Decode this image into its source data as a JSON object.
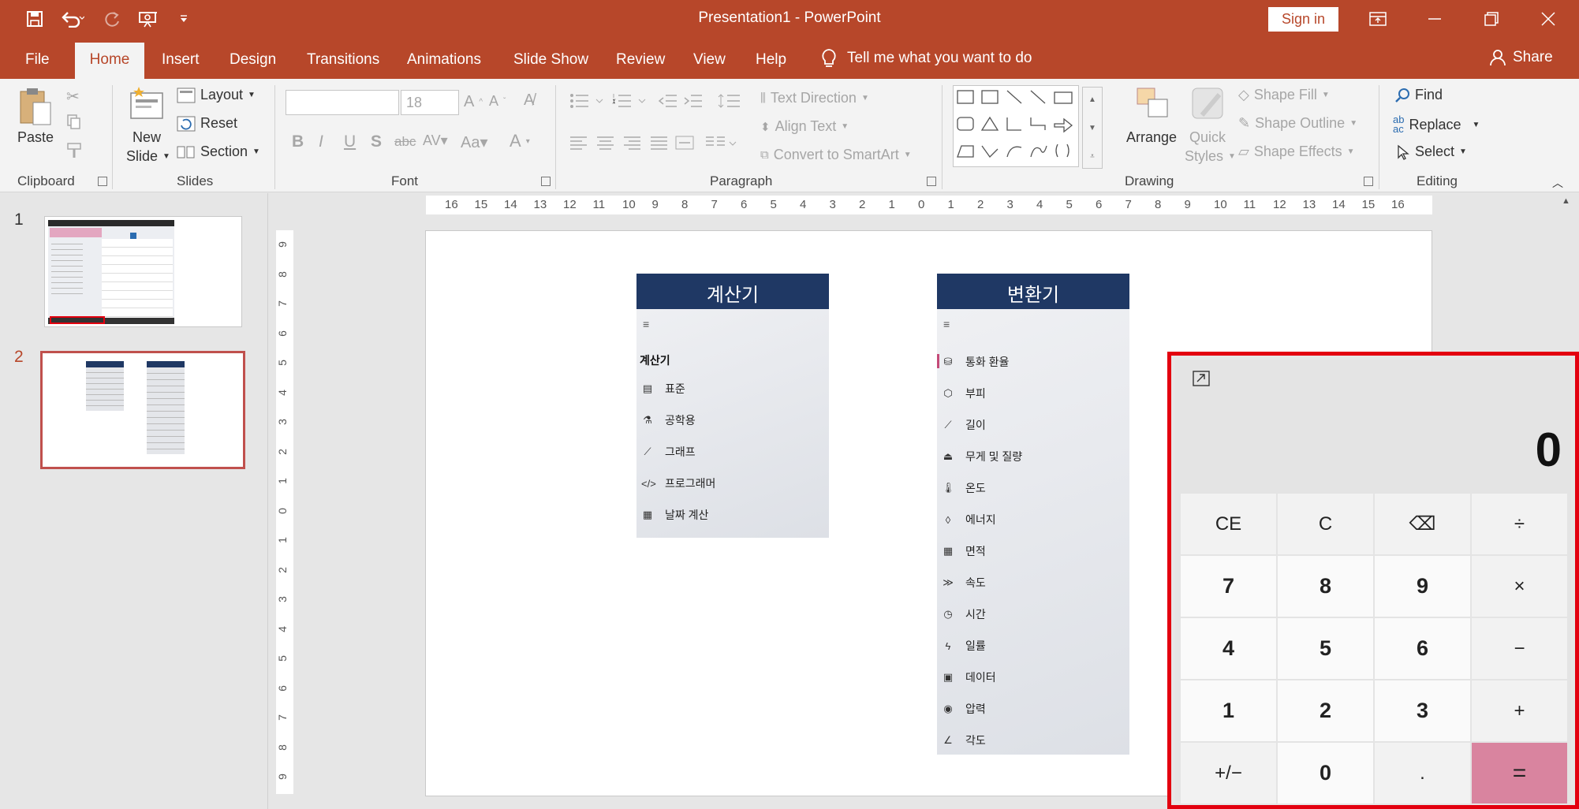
{
  "window": {
    "title": "Presentation1  -  PowerPoint",
    "sign_in": "Sign in"
  },
  "tabs": [
    "File",
    "Home",
    "Insert",
    "Design",
    "Transitions",
    "Animations",
    "Slide Show",
    "Review",
    "View",
    "Help"
  ],
  "tell_me": "Tell me what you want to do",
  "share": "Share",
  "ribbon": {
    "clipboard": {
      "label": "Clipboard",
      "paste": "Paste"
    },
    "slides": {
      "label": "Slides",
      "new_slide_1": "New",
      "new_slide_2": "Slide",
      "layout": "Layout",
      "reset": "Reset",
      "section": "Section"
    },
    "font": {
      "label": "Font",
      "size": "18"
    },
    "paragraph": {
      "label": "Paragraph",
      "text_direction": "Text Direction",
      "align_text": "Align Text",
      "convert_smartart": "Convert to SmartArt"
    },
    "drawing": {
      "label": "Drawing",
      "arrange": "Arrange",
      "quick_1": "Quick",
      "quick_2": "Styles",
      "shape_fill": "Shape Fill",
      "shape_outline": "Shape Outline",
      "shape_effects": "Shape Effects"
    },
    "editing": {
      "label": "Editing",
      "find": "Find",
      "replace": "Replace",
      "select": "Select"
    }
  },
  "slides_pane": [
    "1",
    "2"
  ],
  "ruler": {
    "h": [
      "16",
      "15",
      "14",
      "13",
      "12",
      "11",
      "10",
      "9",
      "8",
      "7",
      "6",
      "5",
      "4",
      "3",
      "2",
      "1",
      "0",
      "1",
      "2",
      "3",
      "4",
      "5",
      "6",
      "7",
      "8",
      "9",
      "10",
      "11",
      "12",
      "13",
      "14",
      "15",
      "16"
    ],
    "v": [
      "9",
      "8",
      "7",
      "6",
      "5",
      "4",
      "3",
      "2",
      "1",
      "0",
      "1",
      "2",
      "3",
      "4",
      "5",
      "6",
      "7",
      "8",
      "9"
    ]
  },
  "calc_panel": {
    "title": "계산기",
    "menu": "≡",
    "header": "계산기",
    "items": [
      "표준",
      "공학용",
      "그래프",
      "프로그래머",
      "날짜 계산"
    ]
  },
  "conv_panel": {
    "title": "변환기",
    "menu": "≡",
    "items": [
      "통화 환율",
      "부피",
      "길이",
      "무게 및 질량",
      "온도",
      "에너지",
      "면적",
      "속도",
      "시간",
      "일률",
      "데이터",
      "압력",
      "각도"
    ]
  },
  "calculator": {
    "display": "0",
    "keys": [
      [
        "CE",
        "C",
        "⌫",
        "÷"
      ],
      [
        "7",
        "8",
        "9",
        "×"
      ],
      [
        "4",
        "5",
        "6",
        "−"
      ],
      [
        "1",
        "2",
        "3",
        "+"
      ],
      [
        "+/−",
        "0",
        ".",
        "="
      ]
    ]
  },
  "colors": {
    "accent": "#b7472a",
    "panel_header": "#1f3864",
    "highlight_border": "#e3000f",
    "equals_key": "#d9849f"
  }
}
